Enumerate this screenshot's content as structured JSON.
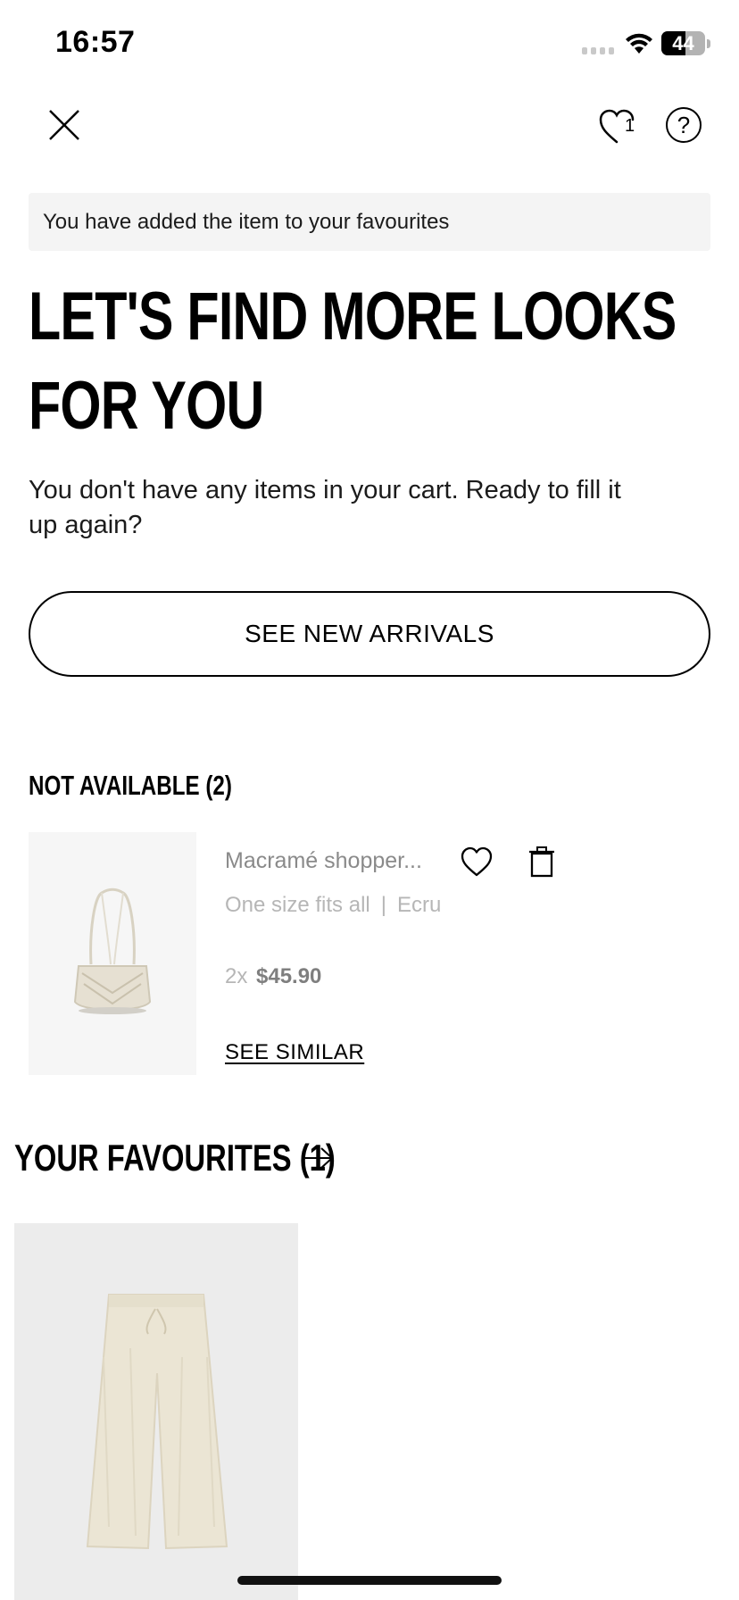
{
  "status_bar": {
    "time": "16:57",
    "battery": "44"
  },
  "header": {
    "favourites_count": "1",
    "help_glyph": "?"
  },
  "toast": {
    "message": "You have added the item to your favourites"
  },
  "empty_cart": {
    "headline": "LET'S FIND MORE LOOKS FOR YOU",
    "subtext": "You don't have any items in your cart. Ready to fill it up again?",
    "cta_label": "SEE NEW ARRIVALS"
  },
  "not_available": {
    "title": "NOT AVAILABLE (2)",
    "item": {
      "name": "Macramé shopper...",
      "size": "One size fits all",
      "separator": "|",
      "color": "Ecru",
      "quantity": "2x",
      "price": "$45.90",
      "see_similar_label": "SEE SIMILAR"
    }
  },
  "favourites": {
    "title": "YOUR FAVOURITES (1)"
  },
  "colors": {
    "toast_bg": "#f4f4f4",
    "muted_text": "#8a8a8a",
    "light_text": "#b6b6b6"
  }
}
